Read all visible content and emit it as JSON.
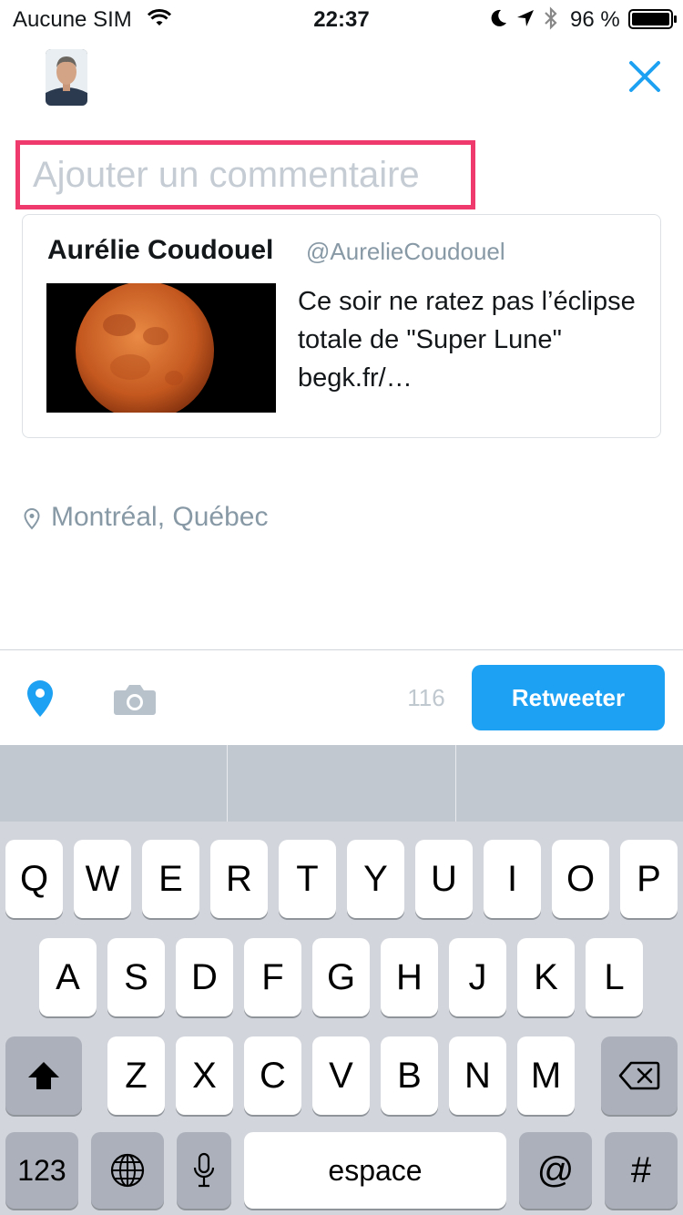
{
  "status_bar": {
    "carrier": "Aucune SIM",
    "time": "22:37",
    "battery": "96 %"
  },
  "compose": {
    "comment_placeholder": "Ajouter un commentaire",
    "highlight_color": "#ef3a6e"
  },
  "quoted_tweet": {
    "author_name": "Aurélie Coudouel",
    "author_handle": "@AurelieCoudouel",
    "text": "Ce soir ne ratez pas l’éclipse totale de \"Super Lune\" begk.fr/…",
    "image": "orange-full-moon"
  },
  "location": {
    "label": "Montréal, Québec"
  },
  "toolbar": {
    "char_count": "116",
    "retweet_label": "Retweeter",
    "accent": "#1da1f2"
  },
  "keyboard": {
    "row1": [
      "Q",
      "W",
      "E",
      "R",
      "T",
      "Y",
      "U",
      "I",
      "O",
      "P"
    ],
    "row2": [
      "A",
      "S",
      "D",
      "F",
      "G",
      "H",
      "J",
      "K",
      "L"
    ],
    "row3": [
      "Z",
      "X",
      "C",
      "V",
      "B",
      "N",
      "M"
    ],
    "numbers_key": "123",
    "space_key": "espace",
    "at_key": "@",
    "hash_key": "#"
  }
}
